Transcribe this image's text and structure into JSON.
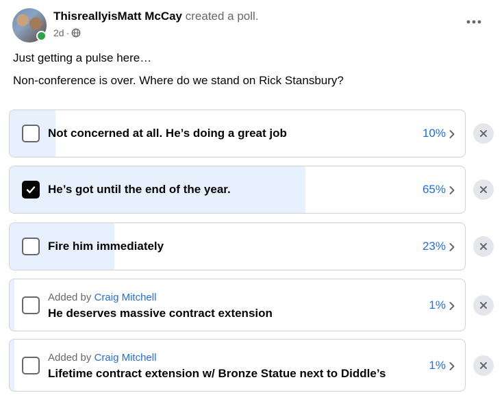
{
  "post": {
    "author": "ThisreallyisMatt McCay",
    "action": "created a poll.",
    "time": "2d",
    "separator": "·",
    "more_icon": "more-horizontal-icon",
    "audience_icon": "globe-icon",
    "lines": [
      "Just getting a pulse here…",
      "Non-conference is over. Where do we stand on Rick Stansbury?"
    ]
  },
  "poll": {
    "accent_color": "#216fdb",
    "fill_color": "#e7f0fd",
    "options": [
      {
        "label": "Not concerned at all. He’s doing a great job",
        "percent": "10%",
        "fraction": 0.1,
        "checked": false,
        "added_by_prefix": "",
        "added_by_name": ""
      },
      {
        "label": "He’s got until the end of the year.",
        "percent": "65%",
        "fraction": 0.65,
        "checked": true,
        "added_by_prefix": "",
        "added_by_name": ""
      },
      {
        "label": "Fire him immediately",
        "percent": "23%",
        "fraction": 0.23,
        "checked": false,
        "added_by_prefix": "",
        "added_by_name": ""
      },
      {
        "label": "He deserves massive contract extension",
        "percent": "1%",
        "fraction": 0.01,
        "checked": false,
        "added_by_prefix": "Added by",
        "added_by_name": "Craig Mitchell"
      },
      {
        "label": "Lifetime contract extension w/ Bronze Statue next to Diddle’s",
        "percent": "1%",
        "fraction": 0.01,
        "checked": false,
        "added_by_prefix": "Added by",
        "added_by_name": "Craig Mitchell"
      }
    ]
  }
}
